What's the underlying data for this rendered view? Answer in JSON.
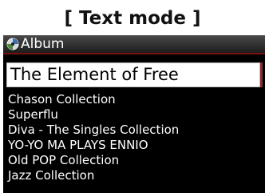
{
  "caption": "[ Text mode ]",
  "title_bar": {
    "icon": "album-disc-icon",
    "title": "Album"
  },
  "album_list": {
    "selected": "The Element of Free",
    "items": [
      "Chason Collection",
      "Superflu",
      "Diva - The Singles Collection",
      "YO-YO MA PLAYS ENNIO",
      "Old POP Collection",
      "Jazz Collection"
    ]
  },
  "colors": {
    "screen_bg": "#000000",
    "accent": "#7a0f0f",
    "selection_bg": "#ffffff"
  }
}
